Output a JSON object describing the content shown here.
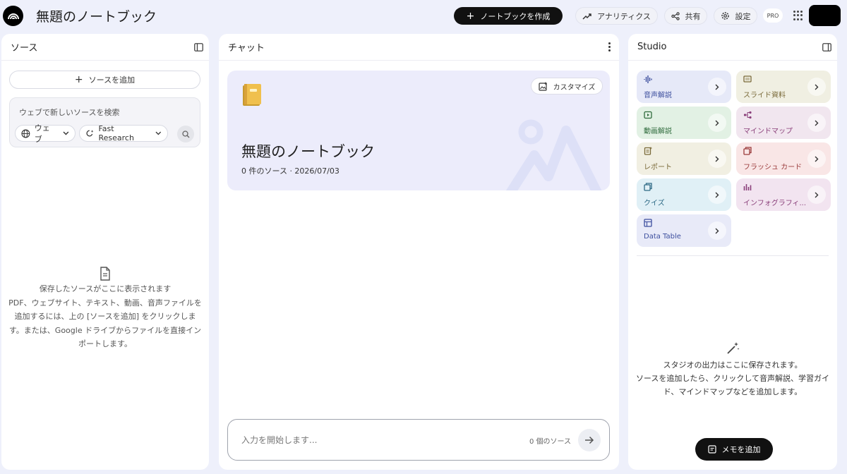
{
  "header": {
    "title": "無題のノートブック",
    "create_label": "ノートブックを作成",
    "analytics_label": "アナリティクス",
    "share_label": "共有",
    "settings_label": "設定",
    "pro_badge": "PRO"
  },
  "sources": {
    "title": "ソース",
    "add_label": "ソースを追加",
    "search_placeholder": "ウェブで新しいソースを検索",
    "web_chip": "ウェブ",
    "research_chip": "Fast Research",
    "empty_line1": "保存したソースがここに表示されます",
    "empty_line2": "PDF、ウェブサイト、テキスト、動画、音声ファイルを追加するには、上の [ソースを追加] をクリックします。または、Google ドライブからファイルを直接インポートします。"
  },
  "chat": {
    "title": "チャット",
    "customize_label": "カスタマイズ",
    "notebook_title": "無題のノートブック",
    "meta": "0 件のソース · 2026/07/03",
    "input_placeholder": "入力を開始します...",
    "source_count": "0 個のソース"
  },
  "studio": {
    "title": "Studio",
    "tiles": [
      {
        "label": "音声解説",
        "icon": "audio-waveform-icon",
        "bg": "#e6e9f8",
        "fg": "#3d4f9e"
      },
      {
        "label": "スライド資料",
        "icon": "slides-icon",
        "bg": "#f0efe2",
        "fg": "#7a6a3a"
      },
      {
        "label": "動画解説",
        "icon": "video-icon",
        "bg": "#e2f1e4",
        "fg": "#2f6b3c"
      },
      {
        "label": "マインドマップ",
        "icon": "mind-map-icon",
        "bg": "#f1e6ef",
        "fg": "#8a3f7a"
      },
      {
        "label": "レポート",
        "icon": "report-icon",
        "bg": "#f1efe2",
        "fg": "#7a6a3a"
      },
      {
        "label": "フラッシュ カード",
        "icon": "flashcard-icon",
        "bg": "#f9e6e6",
        "fg": "#9a3b3b"
      },
      {
        "label": "クイズ",
        "icon": "quiz-icon",
        "bg": "#e0f0f6",
        "fg": "#2d6a85"
      },
      {
        "label": "インフォグラフィ...",
        "icon": "infographic-icon",
        "bg": "#f2e4f0",
        "fg": "#8a3f7a"
      },
      {
        "label": "Data Table",
        "icon": "data-table-icon",
        "bg": "#e8eaf8",
        "fg": "#3d4f9e"
      }
    ],
    "empty_line1": "スタジオの出力はここに保存されます。",
    "empty_line2": "ソースを追加したら、クリックして音声解説、学習ガイド、マインドマップなどを追加します。",
    "memo_label": "メモを追加"
  }
}
